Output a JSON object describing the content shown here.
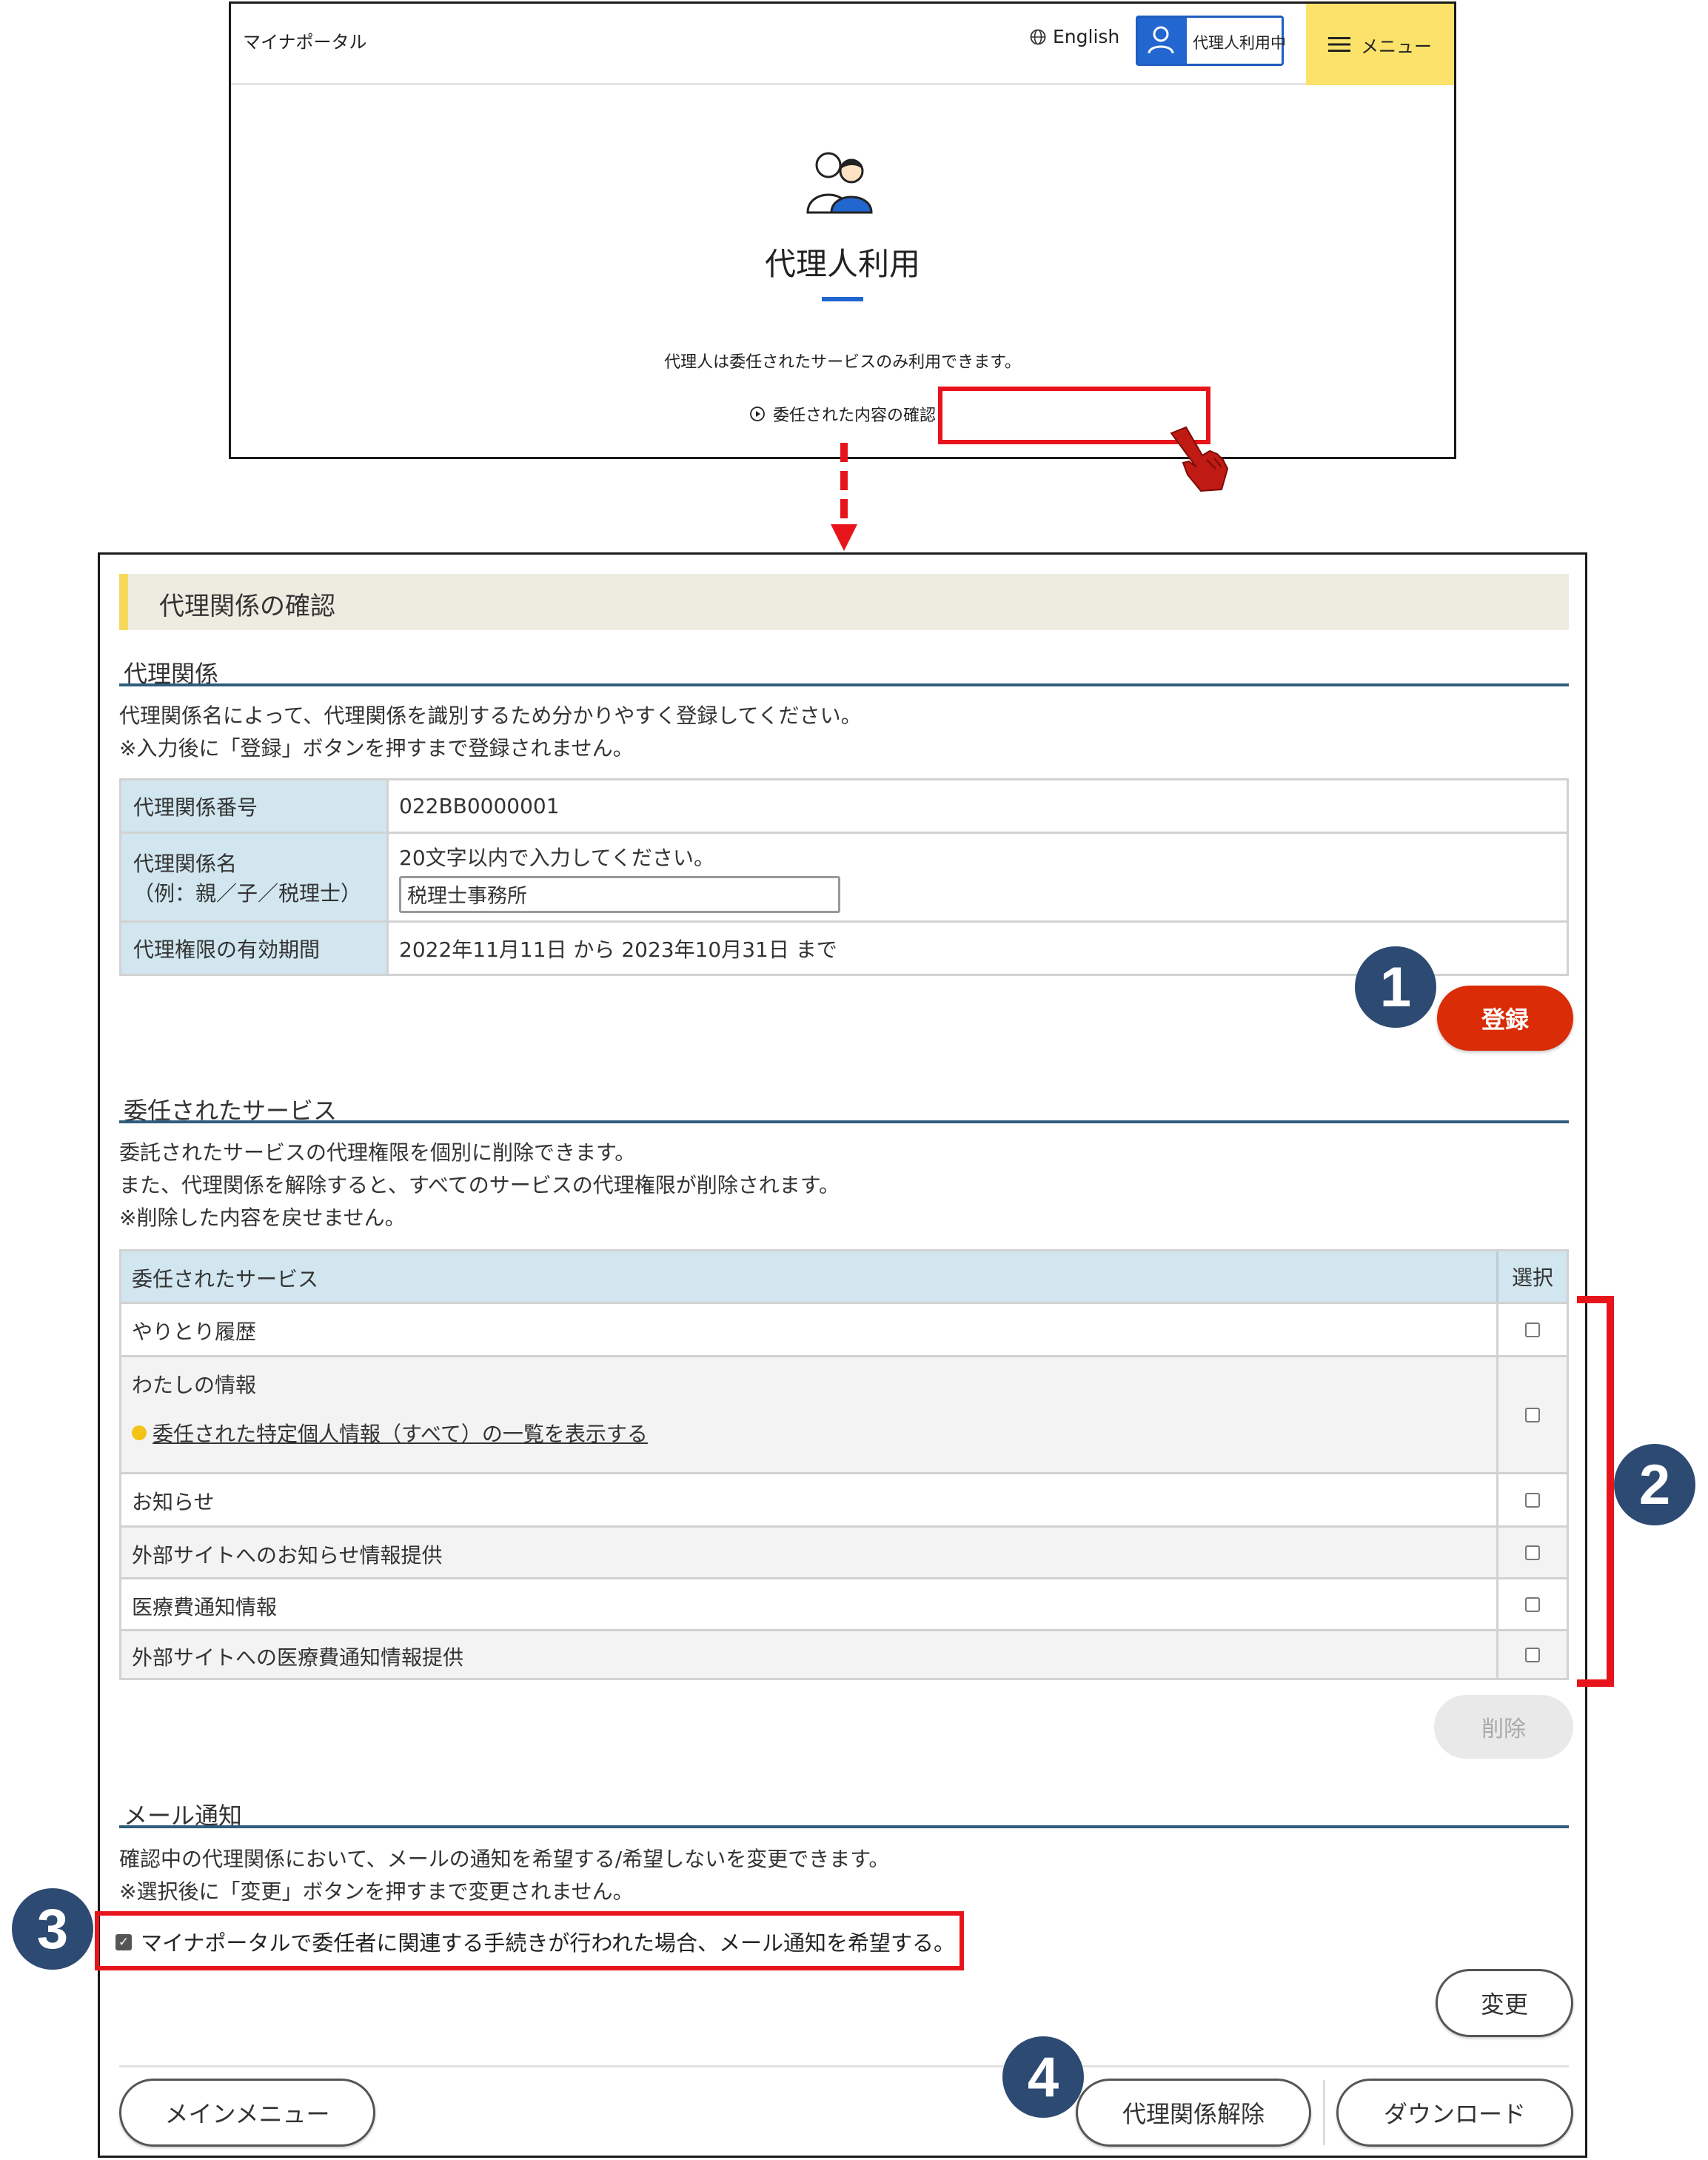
{
  "top": {
    "app_title": "マイナポータル",
    "english_label": "English",
    "proxy_status_label": "代理人利用中",
    "menu_label": "メニュー",
    "title": "代理人利用",
    "description": "代理人は委任されたサービスのみ利用できます。",
    "confirm_link": "委任された内容の確認"
  },
  "page": {
    "header_title": "代理関係の確認",
    "relationship": {
      "heading": "代理関係",
      "desc1": "代理関係名によって、代理関係を識別するため分かりやすく登録してください。",
      "desc2": "※入力後に「登録」ボタンを押すまで登録されません。",
      "number_label": "代理関係番号",
      "number_value": "022BB0000001",
      "name_label_line1": "代理関係名",
      "name_label_line2": "（例：親／子／税理士）",
      "name_hint": "20文字以内で入力してください。",
      "name_value": "税理士事務所",
      "period_label": "代理権限の有効期間",
      "period_value": "2022年11月11日 から 2023年10月31日 まで",
      "register_button": "登録"
    },
    "services": {
      "heading": "委任されたサービス",
      "desc1": "委託されたサービスの代理権限を個別に削除できます。",
      "desc2": "また、代理関係を解除すると、すべてのサービスの代理権限が削除されます。",
      "desc3": "※削除した内容を戻せません。",
      "col_service": "委任されたサービス",
      "col_select": "選択",
      "rows": [
        "やりとり履歴",
        "わたしの情報",
        "お知らせ",
        "外部サイトへのお知らせ情報提供",
        "医療費通知情報",
        "外部サイトへの医療費通知情報提供"
      ],
      "sub_link": "委任された特定個人情報（すべて）の一覧を表示する",
      "delete_button": "削除"
    },
    "mail": {
      "heading": "メール通知",
      "desc1": "確認中の代理関係において、メールの通知を希望する/希望しないを変更できます。",
      "desc2": "※選択後に「変更」ボタンを押すまで変更されません。",
      "checkbox_label": "マイナポータルで委任者に関連する手続きが行われた場合、メール通知を希望する。",
      "checkbox_checked": true,
      "change_button": "変更"
    },
    "footer": {
      "main_menu": "メインメニュー",
      "release": "代理関係解除",
      "download": "ダウンロード"
    }
  },
  "badges": [
    "1",
    "2",
    "3",
    "4"
  ],
  "colors": {
    "highlight_red": "#e8141b",
    "badge_navy": "#2d4a72",
    "register_red": "#da2c06",
    "menu_yellow": "#fbe26a",
    "table_header_blue": "#d1e6ef",
    "accent_blue": "#2266d0"
  }
}
